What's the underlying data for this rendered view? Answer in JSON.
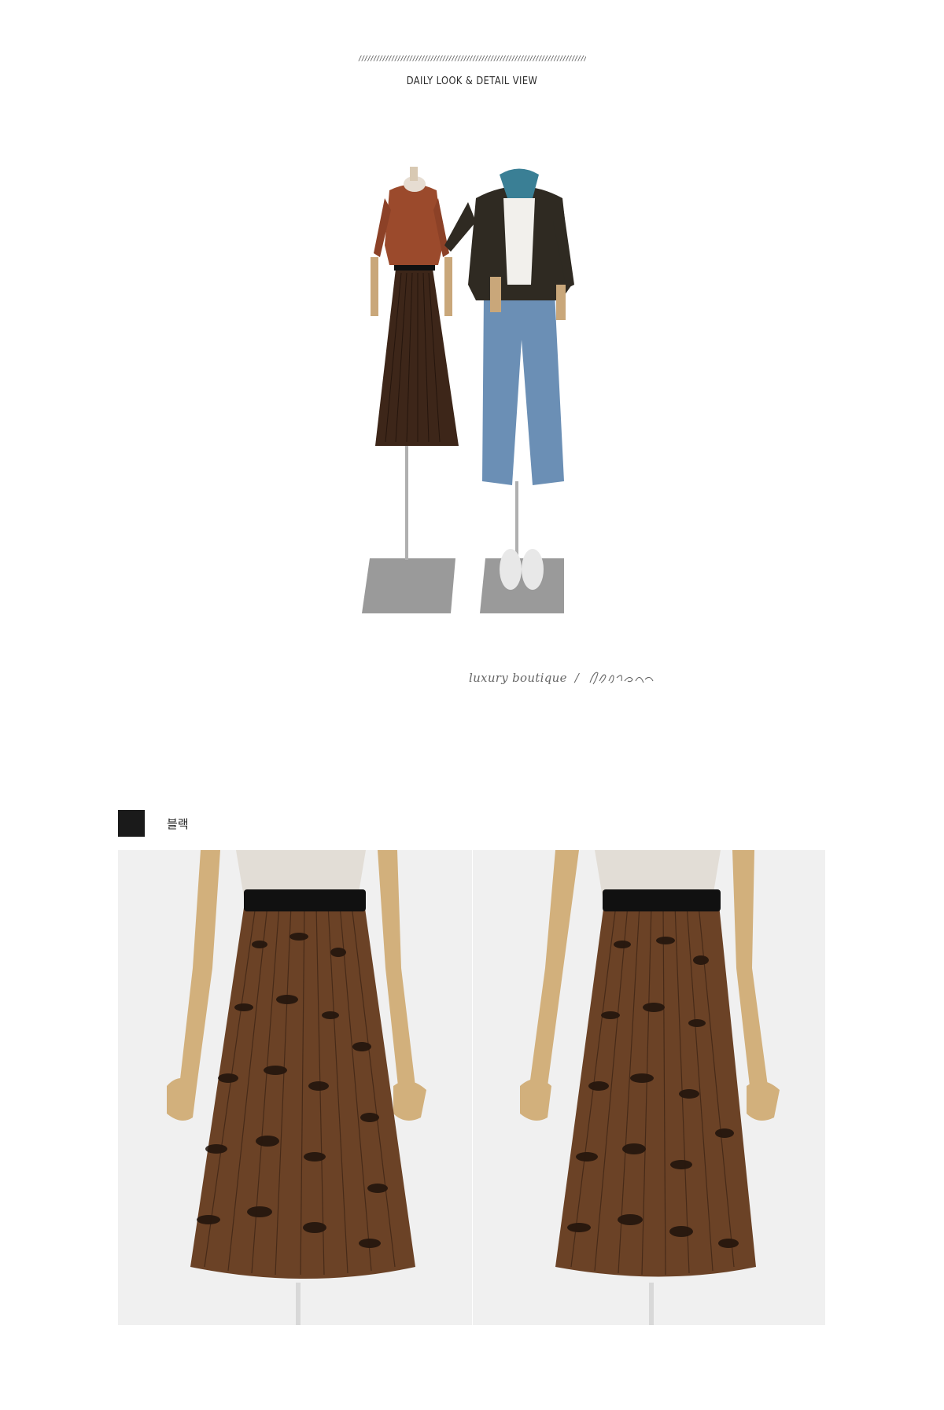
{
  "header": {
    "decor": "//////////////////////////////////////////////////////////////////////////////////////////////////////////",
    "title": "DAILY LOOK & DETAIL VIEW"
  },
  "signature": {
    "text": "luxury boutique",
    "slash": "/",
    "logo_text": "Jblanc"
  },
  "color_options": [
    {
      "label": "블랙",
      "swatch": "#1a1a1a"
    }
  ],
  "colors": {
    "background": "#ffffff",
    "photo_background": "#f0f0f0",
    "skirt_base": "#6b4226",
    "skirt_spots": "#1e120b",
    "waistband": "#111111"
  }
}
